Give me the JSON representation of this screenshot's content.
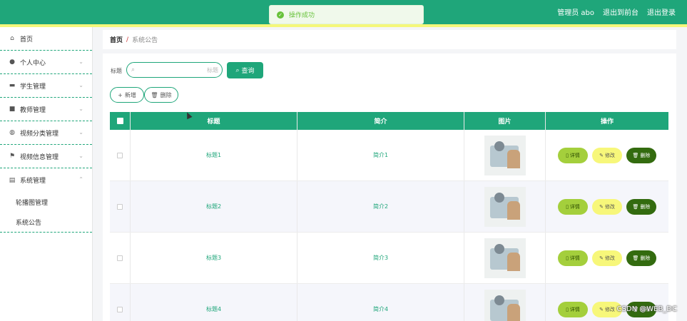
{
  "colors": {
    "primary": "#1fa67a",
    "stripe": "#f4f77a",
    "detail": "#a4cf3c",
    "edit": "#f7f77a",
    "delete": "#336b0f",
    "toast": "#67c23a"
  },
  "header": {
    "user": "管理员 abo",
    "to_front": "退出到前台",
    "logout": "退出登录"
  },
  "toast": {
    "message": "操作成功",
    "icon": "check-circle-icon"
  },
  "sidebar": {
    "items": [
      {
        "label": "首页",
        "icon": "home-icon"
      },
      {
        "label": "个人中心",
        "icon": "user-icon"
      },
      {
        "label": "学生管理",
        "icon": "folder-icon"
      },
      {
        "label": "教师管理",
        "icon": "monitor-icon"
      },
      {
        "label": "视频分类管理",
        "icon": "mic-icon"
      },
      {
        "label": "视频信息管理",
        "icon": "flag-icon"
      },
      {
        "label": "系统管理",
        "icon": "clipboard-icon"
      }
    ],
    "sub_items": [
      {
        "label": "轮播图管理"
      },
      {
        "label": "系统公告"
      }
    ]
  },
  "breadcrumb": {
    "home": "首页",
    "separator": "/",
    "current": "系统公告"
  },
  "search": {
    "label": "标题",
    "placeholder": "标题",
    "query_button": "查询"
  },
  "actions": {
    "add": "新增",
    "delete": "删除"
  },
  "table": {
    "headers": {
      "title": "标题",
      "intro": "简介",
      "image": "图片",
      "ops": "操作"
    },
    "rows": [
      {
        "title": "标题1",
        "intro": "简介1"
      },
      {
        "title": "标题2",
        "intro": "简介2"
      },
      {
        "title": "标题3",
        "intro": "简介3"
      },
      {
        "title": "标题4",
        "intro": "简介4"
      }
    ],
    "op_labels": {
      "detail": "详情",
      "edit": "修改",
      "delete": "删除"
    }
  },
  "watermark": "CSDN @WEB_DC"
}
